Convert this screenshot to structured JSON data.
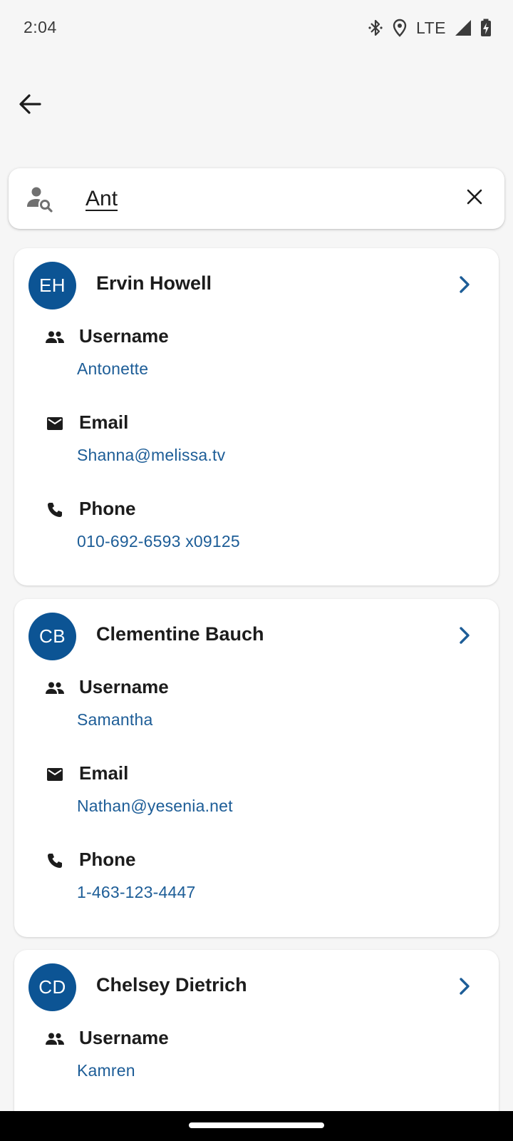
{
  "status_bar": {
    "time": "2:04",
    "network": "LTE",
    "icons": [
      "bluetooth-icon",
      "location-icon",
      "signal-icon",
      "battery-charging-icon"
    ]
  },
  "header": {
    "back_icon": "arrow-back-icon"
  },
  "search": {
    "value": "Ant",
    "leading_icon": "person-search-icon",
    "clear_icon": "close-icon"
  },
  "labels": {
    "username": "Username",
    "email": "Email",
    "phone": "Phone"
  },
  "contacts": [
    {
      "initials": "EH",
      "name": "Ervin Howell",
      "username": "Antonette",
      "email": "Shanna@melissa.tv",
      "phone": "010-692-6593 x09125"
    },
    {
      "initials": "CB",
      "name": "Clementine Bauch",
      "username": "Samantha",
      "email": "Nathan@yesenia.net",
      "phone": "1-463-123-4447"
    },
    {
      "initials": "CD",
      "name": "Chelsey Dietrich",
      "username": "Kamren"
    }
  ],
  "colors": {
    "avatar_bg": "#0c5494",
    "link": "#1d5d97",
    "chevron": "#1d5d97",
    "background": "#f6f6f6"
  }
}
